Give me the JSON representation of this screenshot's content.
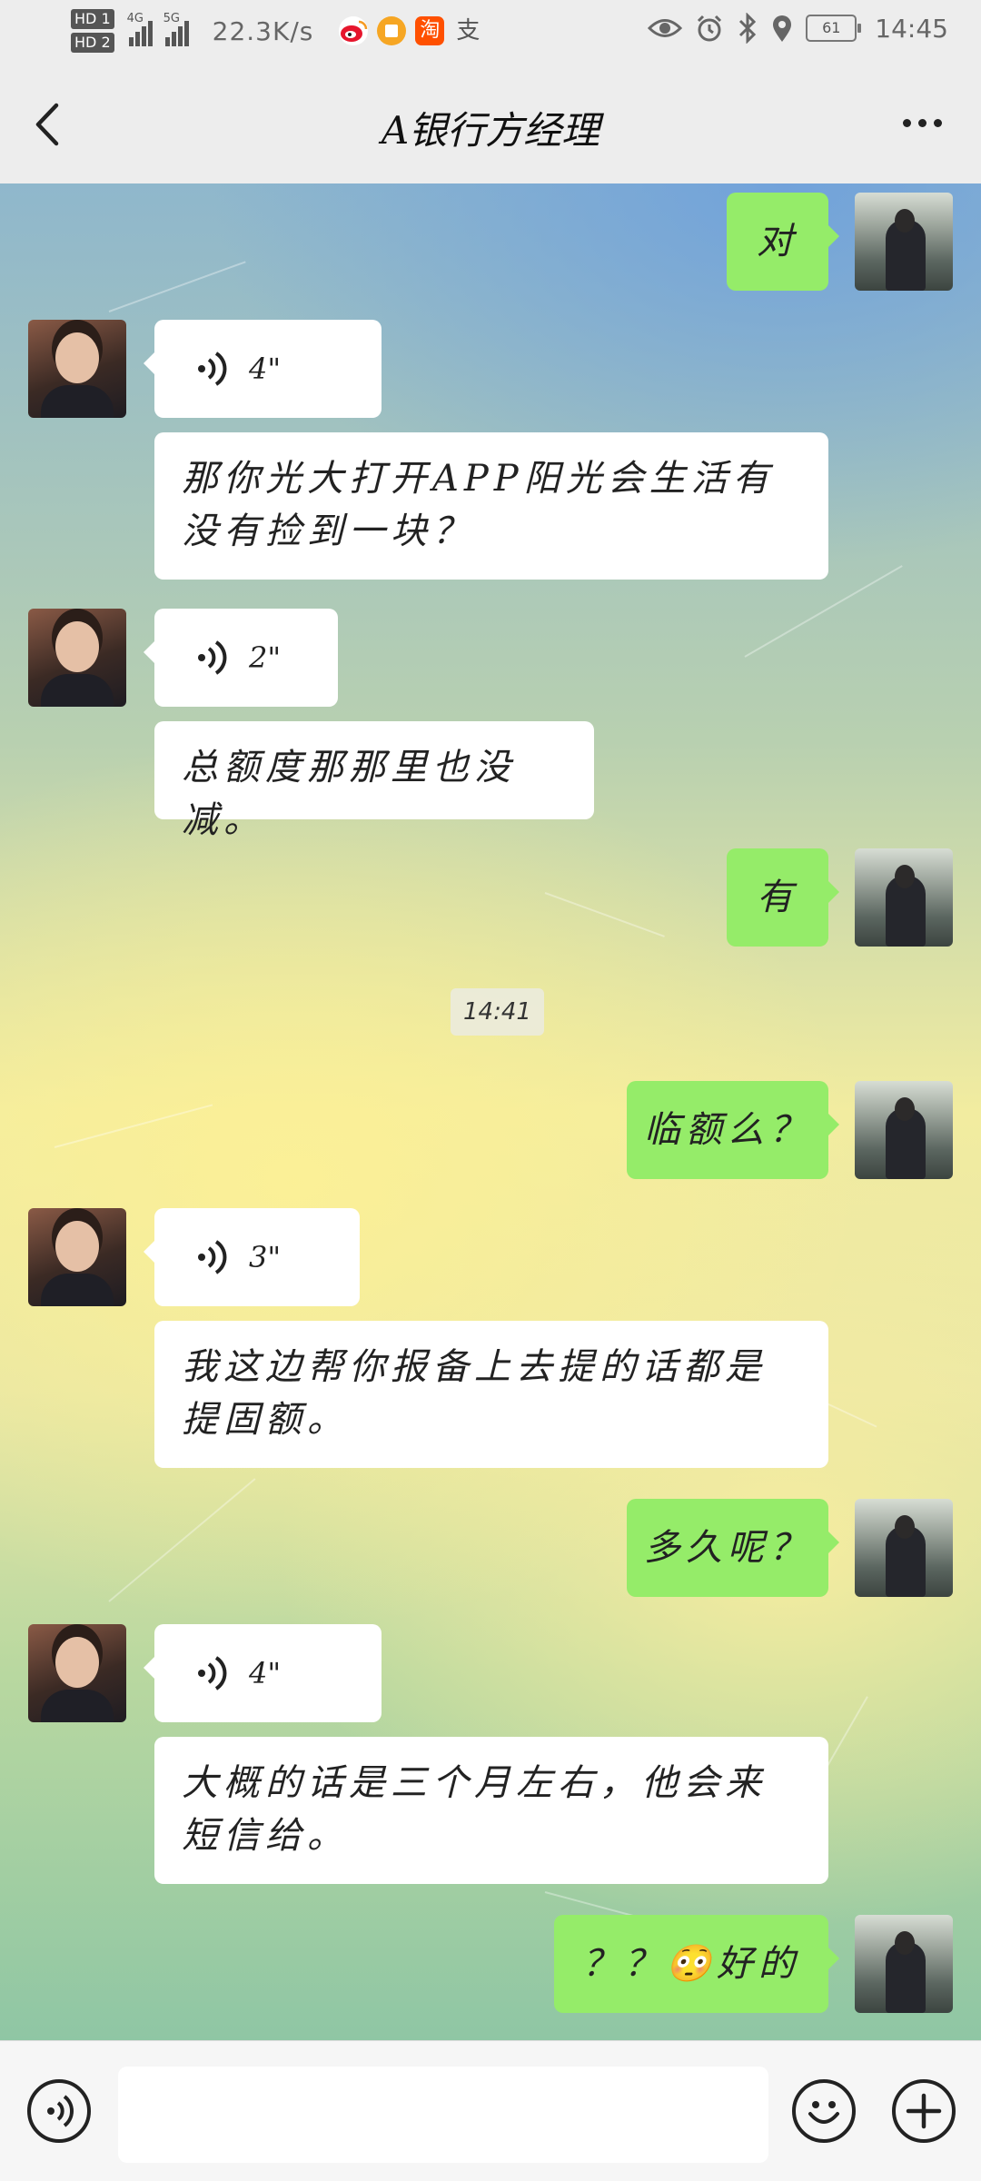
{
  "status_bar": {
    "hd1": "HD 1",
    "hd2": "HD 2",
    "sig1_label": "4G",
    "sig2_label": "5G",
    "net_speed": "22.3K/s",
    "battery": "61",
    "time": "14:45",
    "app_icons": [
      "weibo-icon",
      "orange-app-icon",
      "taobao-icon",
      "alipay-icon"
    ],
    "taobao_glyph": "淘",
    "alipay_glyph": "支",
    "right_icons": [
      "eye-icon",
      "alarm-icon",
      "bluetooth-icon",
      "location-icon"
    ]
  },
  "header": {
    "title": "A银行方经理",
    "back_icon": "back-chevron-icon",
    "more_icon": "more-dots-icon"
  },
  "messages": [
    {
      "side": "right",
      "type": "text",
      "text": "对"
    },
    {
      "side": "left",
      "type": "voice",
      "duration": "4\""
    },
    {
      "side": "left",
      "type": "text",
      "text": "那你光大打开APP阳光会生活有没有捡到一块？"
    },
    {
      "side": "left",
      "type": "voice",
      "duration": "2\""
    },
    {
      "side": "left",
      "type": "text",
      "text": "总额度那那里也没减。"
    },
    {
      "side": "right",
      "type": "text",
      "text": "有"
    },
    {
      "side": "right",
      "type": "text",
      "text": "临额么？"
    },
    {
      "side": "left",
      "type": "voice",
      "duration": "3\""
    },
    {
      "side": "left",
      "type": "text",
      "text": "我这边帮你报备上去提的话都是提固额。"
    },
    {
      "side": "right",
      "type": "text",
      "text": "多久呢？"
    },
    {
      "side": "left",
      "type": "voice",
      "duration": "4\""
    },
    {
      "side": "left",
      "type": "text",
      "text": "大概的话是三个月左右，他会来短信给。"
    },
    {
      "side": "right",
      "type": "text",
      "text": "？？😳好的"
    }
  ],
  "timestamp": "14:41",
  "input_bar": {
    "voice_icon": "voice-mode-icon",
    "emoji_icon": "emoji-icon",
    "plus_icon": "plus-icon",
    "placeholder": ""
  },
  "colors": {
    "green_bubble": "#95ec69",
    "white_bubble": "#ffffff",
    "bar_bg": "#ededed"
  }
}
